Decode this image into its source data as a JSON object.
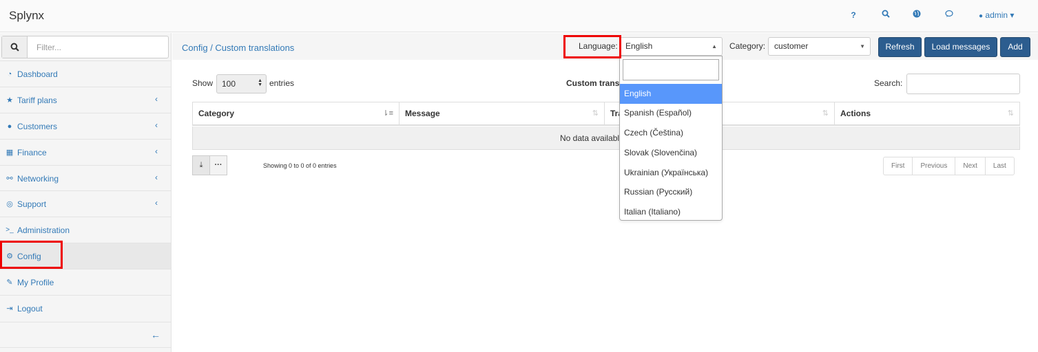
{
  "app": {
    "brand": "Splynx"
  },
  "topbar": {
    "help_icon": "?",
    "user": "admin ▾"
  },
  "sidebar": {
    "filter_placeholder": "Filter...",
    "items": [
      {
        "label": "Dashboard",
        "icon": "dashboard-icon",
        "glyph": "◔",
        "chevron": ""
      },
      {
        "label": "Tariff plans",
        "icon": "star-icon",
        "glyph": "★",
        "chevron": "‹"
      },
      {
        "label": "Customers",
        "icon": "user-icon",
        "glyph": "●",
        "chevron": "‹"
      },
      {
        "label": "Finance",
        "icon": "calculator-icon",
        "glyph": "▦",
        "chevron": "‹"
      },
      {
        "label": "Networking",
        "icon": "sitemap-icon",
        "glyph": "⚯",
        "chevron": "‹"
      },
      {
        "label": "Support",
        "icon": "lifebuoy-icon",
        "glyph": "◎",
        "chevron": "‹"
      },
      {
        "label": "Administration",
        "icon": "terminal-icon",
        "glyph": ">_",
        "chevron": ""
      },
      {
        "label": "Config",
        "icon": "cogs-icon",
        "glyph": "⚙",
        "chevron": ""
      },
      {
        "label": "My Profile",
        "icon": "pencil-icon",
        "glyph": "✎",
        "chevron": ""
      },
      {
        "label": "Logout",
        "icon": "sign-out-icon",
        "glyph": "⇥",
        "chevron": ""
      }
    ],
    "collapse_glyph": "←"
  },
  "header": {
    "breadcrumb": "Config / Custom translations",
    "language_label": "Language:",
    "language_value": "English",
    "category_label": "Category:",
    "category_value": "customer",
    "refresh": "Refresh",
    "load_messages": "Load messages",
    "add": "Add"
  },
  "table": {
    "show_label": "Show",
    "show_value": "100",
    "entries_label": "entries",
    "title": "Custom trans",
    "search_label": "Search:",
    "columns": [
      "Category",
      "Message",
      "Tra",
      "",
      "Actions"
    ],
    "empty": "No data availabl",
    "showing": "Showing 0 to 0 of 0 entries",
    "pager": [
      "First",
      "Previous",
      "Next",
      "Last"
    ]
  },
  "dropdown": {
    "options": [
      "English",
      "Spanish (Español)",
      "Czech (Čeština)",
      "Slovak (Slovenčina)",
      "Ukrainian (Українська)",
      "Russian (Русский)",
      "Italian (Italiano)"
    ],
    "selected": "English"
  },
  "colors": {
    "accent": "#337ab7",
    "button": "#2c5d8f",
    "highlight": "#5897fb",
    "annotation": "#ee0000"
  }
}
